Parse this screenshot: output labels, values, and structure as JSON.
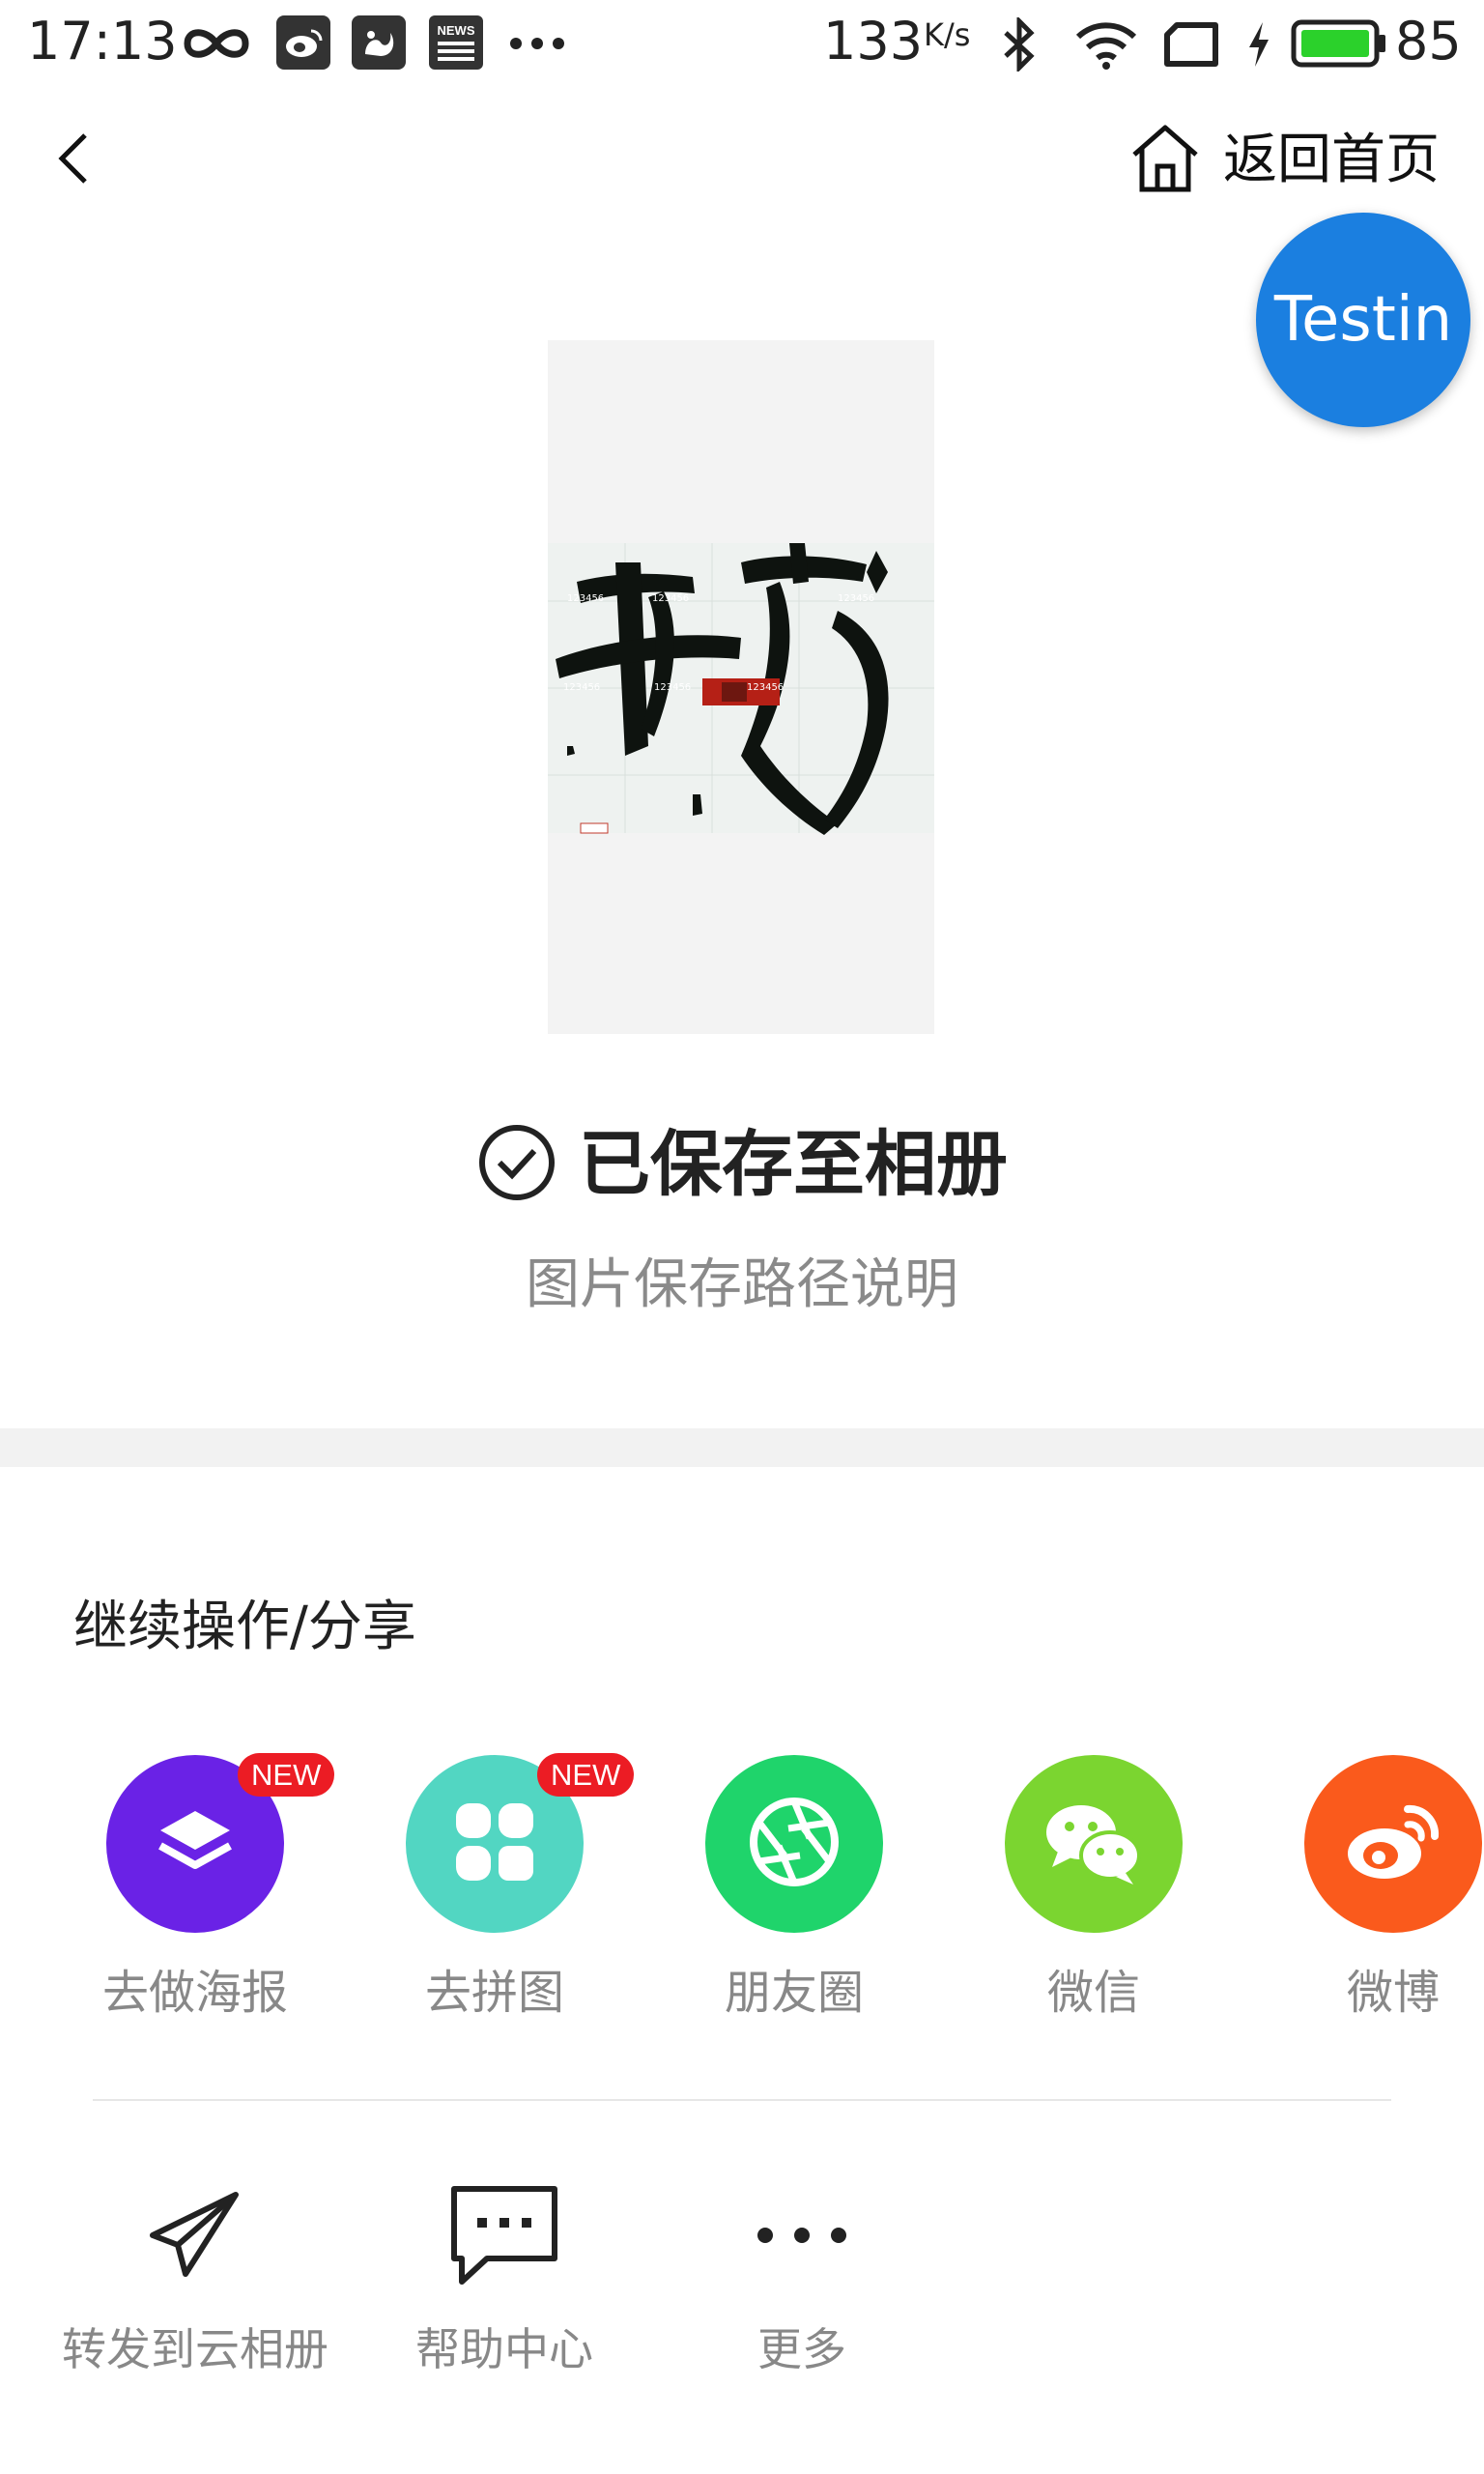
{
  "status_bar": {
    "time": "17:13",
    "net_speed": "133",
    "net_unit": "K/s",
    "battery": "85",
    "news_icon_text": "NEWS"
  },
  "header": {
    "home_label": "返回首页",
    "floating_badge": "Testin"
  },
  "result": {
    "saved_text": "已保存至相册",
    "path_link": "图片保存路径说明"
  },
  "share_section": {
    "title": "继续操作/分享",
    "new_badge": "NEW",
    "items": [
      {
        "label": "去做海报",
        "color": "#6a22e6",
        "icon": "layers-icon",
        "is_new": true
      },
      {
        "label": "去拼图",
        "color": "#52d6c2",
        "icon": "grid-icon",
        "is_new": true
      },
      {
        "label": "朋友圈",
        "color": "#1fd46b",
        "icon": "aperture-icon",
        "is_new": false
      },
      {
        "label": "微信",
        "color": "#7bd530",
        "icon": "wechat-icon",
        "is_new": false
      },
      {
        "label": "微博",
        "color": "#fa5a1c",
        "icon": "weibo-icon",
        "is_new": false
      }
    ]
  },
  "tools": {
    "items": [
      {
        "label": "转发到云相册",
        "icon": "paper-plane-icon"
      },
      {
        "label": "帮助中心",
        "icon": "chat-bubble-icon"
      },
      {
        "label": "更多",
        "icon": "more-dots-icon"
      }
    ]
  },
  "preview_image": {
    "watermark_text": "123456"
  },
  "colors": {
    "accent_blue": "#1b7fe0",
    "new_badge_red": "#ec1c24",
    "battery_green": "#2bd12b"
  }
}
